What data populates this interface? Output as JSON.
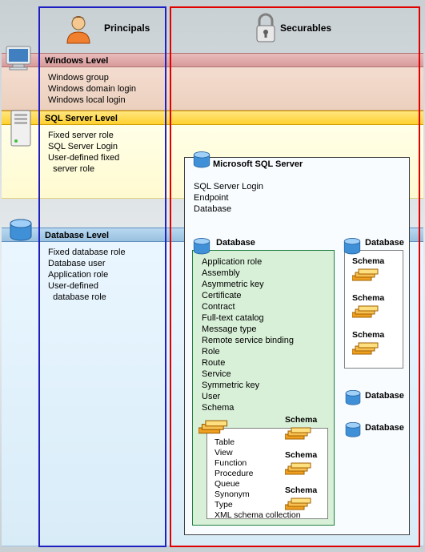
{
  "columns": {
    "principals": {
      "title": "Principals"
    },
    "securables": {
      "title": "Securables"
    }
  },
  "levels": {
    "windows": {
      "header": "Windows Level",
      "items": [
        "Windows group",
        "Windows domain login",
        "Windows local login"
      ]
    },
    "sqlserver": {
      "header": "SQL Server Level",
      "items": [
        "Fixed server role",
        "SQL Server Login",
        "User-defined fixed",
        "  server role"
      ]
    },
    "database": {
      "header": "Database Level",
      "items": [
        "Fixed database role",
        "Database user",
        "Application role",
        "User-defined",
        "  database role"
      ]
    }
  },
  "securables": {
    "server": {
      "title": "Microsoft SQL Server",
      "items": [
        "SQL Server Login",
        "Endpoint",
        "Database"
      ]
    },
    "database": {
      "title": "Database",
      "items": [
        "Application role",
        "Assembly",
        "Asymmetric key",
        "Certificate",
        "Contract",
        "Full-text catalog",
        "Message type",
        "Remote service binding",
        "Role",
        "Route",
        "Service",
        "Symmetric key",
        "User",
        "Schema"
      ]
    },
    "schema": {
      "title": "Schema",
      "items": [
        "Table",
        "View",
        "Function",
        "Procedure",
        "Queue",
        "Synonym",
        "Type",
        "XML schema collection"
      ]
    },
    "right_db": {
      "title": "Database",
      "schemas": [
        "Schema",
        "Schema",
        "Schema"
      ]
    },
    "mini_schemas": [
      "Schema",
      "Schema",
      "Schema"
    ],
    "mini_dbs": [
      "Database",
      "Database"
    ]
  }
}
